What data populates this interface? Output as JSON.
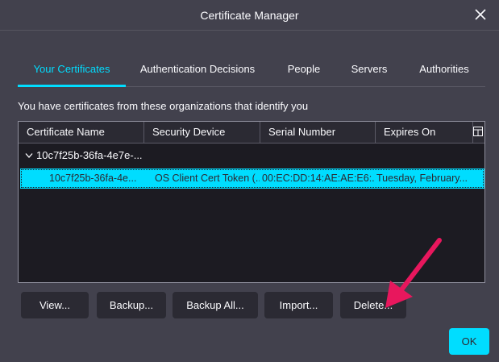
{
  "dialog": {
    "title": "Certificate Manager"
  },
  "tabs": [
    {
      "label": "Your Certificates",
      "active": true
    },
    {
      "label": "Authentication Decisions",
      "active": false
    },
    {
      "label": "People",
      "active": false
    },
    {
      "label": "Servers",
      "active": false
    },
    {
      "label": "Authorities",
      "active": false
    }
  ],
  "description": "You have certificates from these organizations that identify you",
  "table": {
    "columns": [
      "Certificate Name",
      "Security Device",
      "Serial Number",
      "Expires On"
    ],
    "group": {
      "label": "10c7f25b-36fa-4e7e-...",
      "expanded": true
    },
    "rows": [
      {
        "name": "10c7f25b-36fa-4e...",
        "device": "OS Client Cert Token (...",
        "serial": "00:EC:DD:14:AE:AE:E6:...",
        "expires": "Tuesday, February...",
        "selected": true
      }
    ]
  },
  "buttons": {
    "view": "View...",
    "backup": "Backup...",
    "backup_all": "Backup All...",
    "import": "Import...",
    "delete": "Delete..."
  },
  "ok_label": "OK",
  "colors": {
    "accent": "#00ddff",
    "background": "#42414d",
    "annotation_arrow": "#e8175d"
  },
  "icons": {
    "close": "close-icon",
    "twisty": "chevron-down-icon",
    "column_picker": "column-picker-icon",
    "annotation": "annotation-arrow"
  }
}
